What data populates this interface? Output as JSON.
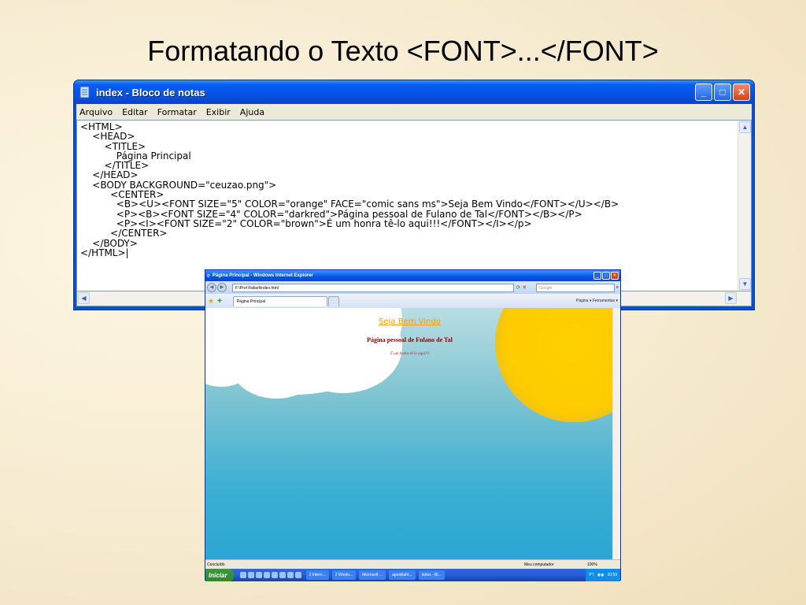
{
  "slide": {
    "title": "Formatando o Texto <FONT>...</FONT>"
  },
  "notepad": {
    "title": "index - Bloco de notas",
    "menu": [
      "Arquivo",
      "Editar",
      "Formatar",
      "Exibir",
      "Ajuda"
    ],
    "code_lines": [
      "<HTML>",
      "    <HEAD>",
      "        <TITLE>",
      "            Página Principal",
      "        </TITLE>",
      "    </HEAD>",
      "    <BODY BACKGROUND=\"ceuzao.png\">",
      "          <CENTER>",
      "            <B><U><FONT SIZE=\"5\" COLOR=\"orange\" FACE=\"comic sans ms\">Seja Bem Vindo</FONT></U></B>",
      "            <P><B><FONT SIZE=\"4\" COLOR=\"darkred\">Página pessoal de Fulano de Tal</FONT></B></P>",
      "            <P><I><FONT SIZE=\"2\" COLOR=\"brown\">É um honra tê-lo aqui!!!</FONT></I></p>",
      "          </CENTER>",
      "    </BODY>",
      "</HTML>|"
    ]
  },
  "browser": {
    "title": "Página Principal - Windows Internet Explorer",
    "address": "F:\\Prof Rafael\\index.html",
    "search_placeholder": "Google",
    "tab_label": "Página Principal",
    "tools_label": "Página ▾  Ferramentas ▾",
    "page": {
      "heading": "Seja Bem Vindo",
      "subheading": "Página pessoal de Fulano de Tal",
      "tagline": "É um honra tê-lo aqui!!!"
    },
    "status": {
      "main": "Concluído",
      "zone": "Meu computador",
      "zoom": "100%"
    }
  },
  "taskbar": {
    "start_label": "Iniciar",
    "items": [
      "2 Intern...",
      "2 Windo...",
      "Microsoft ...",
      "apostilaht...",
      "index - Bl..."
    ],
    "lang": "PT",
    "clock": "20:59"
  }
}
